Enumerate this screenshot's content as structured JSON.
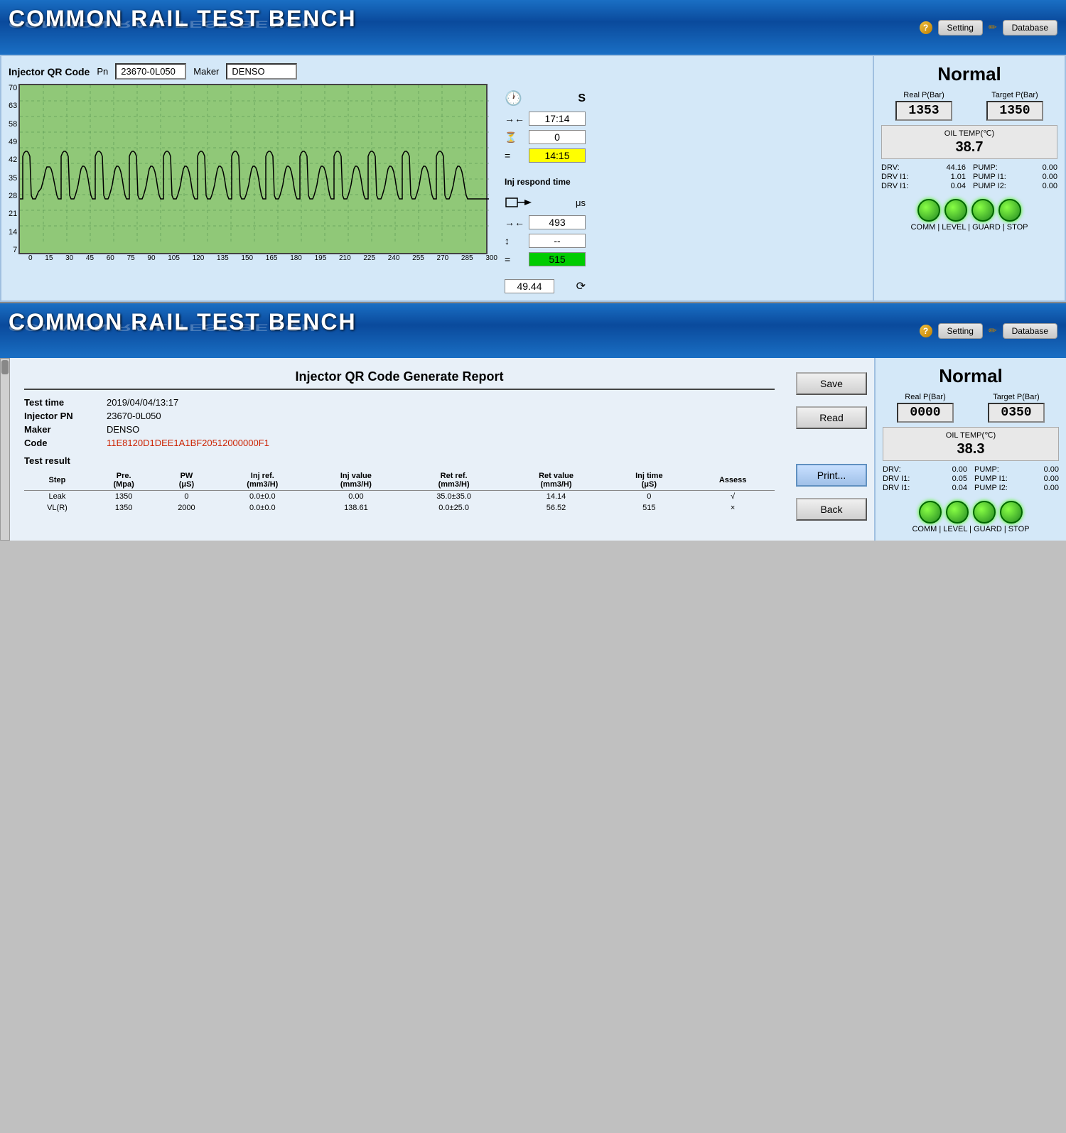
{
  "app": {
    "title": "COMMON RAIL TEST BENCH",
    "setting_label": "Setting",
    "database_label": "Database"
  },
  "top_section": {
    "injector_qr_label": "Injector QR Code",
    "pn_label": "Pn",
    "pn_value": "23670-0L050",
    "maker_label": "Maker",
    "maker_value": "DENSO",
    "timer_s_label": "S",
    "timer_1": "17:14",
    "timer_2": "0",
    "timer_3": "14:15",
    "inj_respond_label": "Inj respond time",
    "unit_us": "μs",
    "respond_1": "493",
    "respond_2": "--",
    "respond_3": "515",
    "misc_value": "49.44",
    "status": "Normal",
    "real_p_label": "Real P(Bar)",
    "target_p_label": "Target P(Bar)",
    "real_p_value": "1353",
    "target_p_value": "1350",
    "oil_temp_label": "OIL TEMP(℃)",
    "oil_temp_value": "38.7",
    "drv_label": "DRV:",
    "drv_value": "44.16",
    "pump_label": "PUMP:",
    "pump_value": "0.00",
    "drv_i1_label": "DRV I1:",
    "drv_i1_value": "1.01",
    "pump_i1_label": "PUMP I1:",
    "pump_i1_value": "0.00",
    "drv_i2_label": "DRV I1:",
    "drv_i2_value": "0.04",
    "pump_i2_label": "PUMP I2:",
    "pump_i2_value": "0.00",
    "comm_label": "COMM | LEVEL | GUARD | STOP",
    "y_labels": [
      "70",
      "63",
      "58",
      "49",
      "42",
      "35",
      "28",
      "21",
      "14",
      "7"
    ],
    "x_labels": [
      "0",
      "15",
      "30",
      "45",
      "60",
      "75",
      "90",
      "105",
      "120",
      "135",
      "150",
      "165",
      "180",
      "195",
      "210",
      "225",
      "240",
      "255",
      "270",
      "285",
      "300"
    ]
  },
  "bottom_section": {
    "report_title": "Injector QR Code Generate Report",
    "test_time_label": "Test time",
    "test_time_value": "2019/04/04/13:17",
    "injector_pn_label": "Injector PN",
    "injector_pn_value": "23670-0L050",
    "maker_label": "Maker",
    "maker_value": "DENSO",
    "code_label": "Code",
    "code_value": "11E8120D1DEE1A1BF20512000000F1",
    "test_result_label": "Test result",
    "table_headers": [
      "Step",
      "Pre.\n(Mpa)",
      "PW\n(μS)",
      "Inj ref.\n(mm3/H)",
      "Inj value\n(mm3/H)",
      "Ret ref.\n(mm3/H)",
      "Ret value\n(mm3/H)",
      "Inj time\n(μS)",
      "Assess"
    ],
    "table_rows": [
      [
        "Leak",
        "1350",
        "0",
        "0.0±0.0",
        "0.00",
        "35.0±35.0",
        "14.14",
        "0",
        "√"
      ],
      [
        "VL(R)",
        "1350",
        "2000",
        "0.0±0.0",
        "138.61",
        "0.0±25.0",
        "56.52",
        "515",
        "×"
      ]
    ],
    "save_label": "Save",
    "read_label": "Read",
    "print_label": "Print...",
    "back_label": "Back",
    "status": "Normal",
    "real_p_label": "Real P(Bar)",
    "target_p_label": "Target P(Bar)",
    "real_p_value": "0000",
    "target_p_value": "0350",
    "oil_temp_label": "OIL TEMP(℃)",
    "oil_temp_value": "38.3",
    "drv_label": "DRV:",
    "drv_value": "0.00",
    "pump_label": "PUMP:",
    "pump_value": "0.00",
    "drv_i1_label": "DRV I1:",
    "drv_i1_value": "0.05",
    "pump_i1_label": "PUMP I1:",
    "pump_i1_value": "0.00",
    "drv_i2_label": "DRV I1:",
    "drv_i2_value": "0.04",
    "pump_i2_label": "PUMP I2:",
    "pump_i2_value": "0.00",
    "comm_label": "COMM | LEVEL | GUARD | STOP"
  }
}
